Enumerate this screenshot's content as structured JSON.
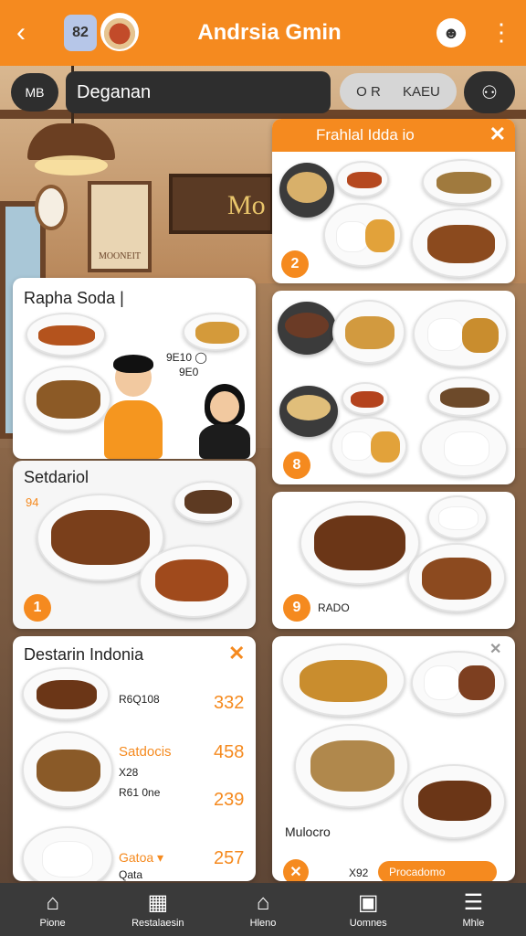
{
  "header": {
    "title": "Andrsia Gmin",
    "chip_text": "82",
    "colors": {
      "accent": "#f58a1f",
      "dark": "#2e2e2e"
    }
  },
  "search": {
    "badge": "MB",
    "value": "Deganan",
    "seg_a": "O R",
    "seg_b": "KAEU"
  },
  "background": {
    "sign_text": "MOONEIT",
    "board_text": "Mo"
  },
  "cards": {
    "special": {
      "title": "Frahlal Idda io",
      "badge": "2"
    },
    "popular": {
      "title": "Rapha Soda |",
      "note_a": "9E10 ◯",
      "note_b": "9E0"
    },
    "set_b": {
      "badge": "8"
    },
    "setdaniel": {
      "title": "Setdariol",
      "num": "94",
      "badge": "1"
    },
    "set_c": {
      "badge": "9",
      "label": "RADO"
    },
    "indonesia": {
      "title": "Destarin Indonia",
      "items": [
        {
          "name": "R6Q108",
          "price": "332"
        },
        {
          "name": "Satdocis",
          "sub_a": "X28",
          "sub_b": "R61 0ne",
          "price": "458",
          "price2": "239"
        },
        {
          "name": "Gatoa ▾",
          "sub": "Qata",
          "price": "257"
        }
      ]
    },
    "mixed": {
      "title": "Mulocro",
      "num": "X92",
      "button": "Procadomo"
    }
  },
  "bottom_nav": [
    {
      "icon": "home-icon",
      "label": "Pione"
    },
    {
      "icon": "calendar-icon",
      "label": "Restalaesin"
    },
    {
      "icon": "house-icon",
      "label": "Hleno"
    },
    {
      "icon": "window-icon",
      "label": "Uomnes"
    },
    {
      "icon": "menu-icon",
      "label": "Mhle"
    }
  ]
}
